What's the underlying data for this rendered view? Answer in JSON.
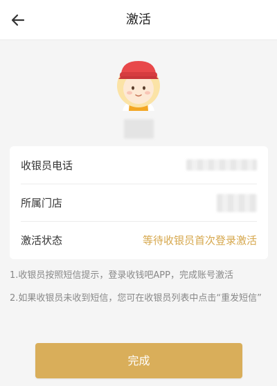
{
  "header": {
    "title": "激活",
    "back_icon": "arrow-left-icon"
  },
  "profile": {
    "avatar_icon": "cashier-avatar-icon"
  },
  "info": {
    "rows": [
      {
        "label": "收银员电话",
        "value": ""
      },
      {
        "label": "所属门店",
        "value": ""
      },
      {
        "label": "激活状态",
        "value": "等待收银员首次登录激活"
      }
    ]
  },
  "hints": {
    "line1": "1.收银员按照短信提示，登录收钱吧APP，完成账号激活",
    "line2": "2.如果收银员未收到短信，您可在收银员列表中点击“重发短信”"
  },
  "done_button": {
    "label": "完成"
  },
  "colors": {
    "accent": "#d9ae5a",
    "status_text": "#d6a74c",
    "background": "#f5f5f5"
  }
}
